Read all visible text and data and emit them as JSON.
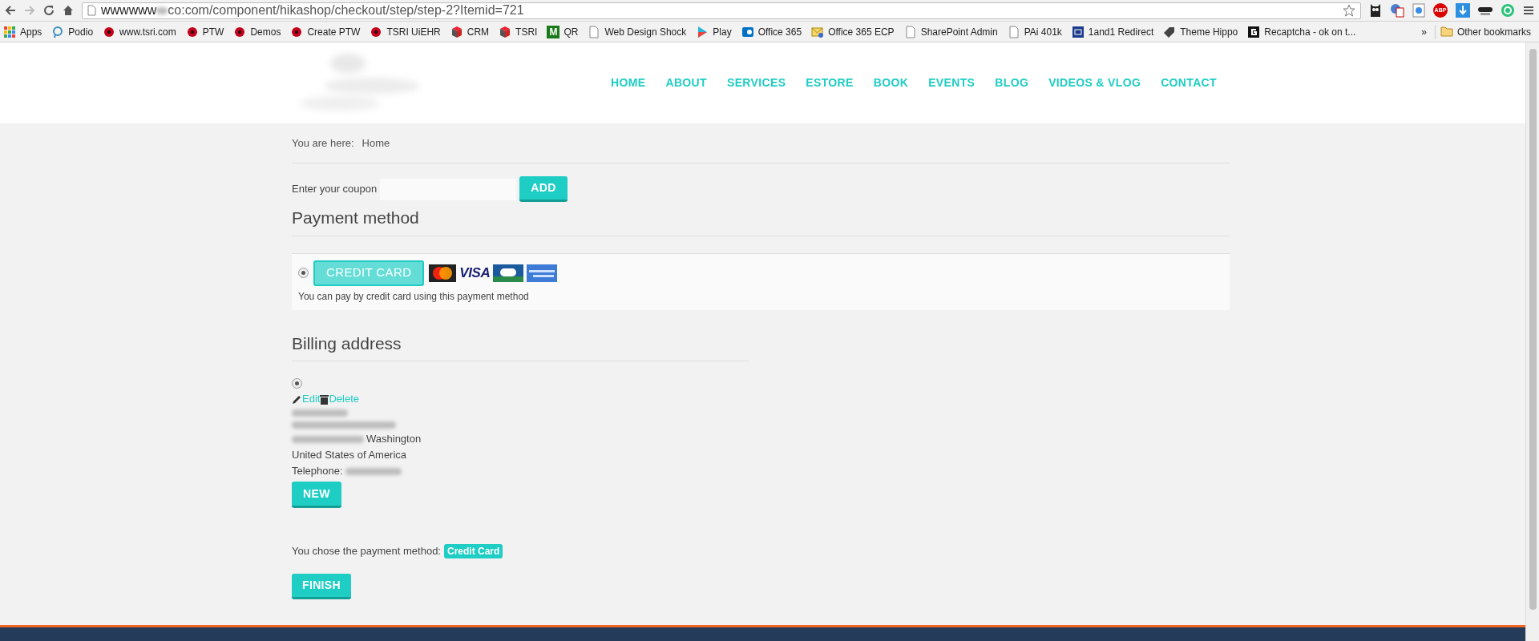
{
  "browser": {
    "url_start": "wwwwww",
    "url_rest": "co:com/component/hikashop/checkout/step/step-2?Itemid=721",
    "bookmarks": [
      {
        "label": "Apps",
        "kind": "apps"
      },
      {
        "label": "Podio",
        "kind": "podio"
      },
      {
        "label": "www.tsri.com",
        "kind": "dot"
      },
      {
        "label": "PTW",
        "kind": "dot"
      },
      {
        "label": "Demos",
        "kind": "dot"
      },
      {
        "label": "Create PTW",
        "kind": "dot"
      },
      {
        "label": "TSRI UiEHR",
        "kind": "dot"
      },
      {
        "label": "CRM",
        "kind": "cube"
      },
      {
        "label": "TSRI",
        "kind": "cube"
      },
      {
        "label": "QR",
        "kind": "m",
        "glyph": "M"
      },
      {
        "label": "Web Design Shock",
        "kind": "page"
      },
      {
        "label": "Play",
        "kind": "play"
      },
      {
        "label": "Office 365",
        "kind": "sharepoint"
      },
      {
        "label": "Office 365 ECP",
        "kind": "envelope"
      },
      {
        "label": "SharePoint Admin",
        "kind": "page"
      },
      {
        "label": "PAi 401k",
        "kind": "page"
      },
      {
        "label": "1and1 Redirect",
        "kind": "oneandone"
      },
      {
        "label": "Theme Hippo",
        "kind": "tag"
      },
      {
        "label": "Recaptcha - ok on t...",
        "kind": "g"
      }
    ],
    "overflow": "»",
    "other_bookmarks": "Other bookmarks",
    "abp": "ABP"
  },
  "nav": [
    {
      "label": "HOME"
    },
    {
      "label": "ABOUT"
    },
    {
      "label": "SERVICES"
    },
    {
      "label": "ESTORE"
    },
    {
      "label": "BOOK"
    },
    {
      "label": "EVENTS"
    },
    {
      "label": "BLOG"
    },
    {
      "label": "VIDEOS & VLOG"
    },
    {
      "label": "CONTACT"
    }
  ],
  "breadcrumb": {
    "label": "You are here:",
    "items": [
      "Home"
    ]
  },
  "coupon": {
    "label": "Enter your coupon",
    "button": "ADD"
  },
  "payment": {
    "heading": "Payment method",
    "methods": [
      {
        "name": "CREDIT CARD",
        "selected": true,
        "description": "You can pay by credit card using this payment method",
        "cards": [
          {
            "kind": "mastercard"
          },
          {
            "kind": "visa",
            "label": "VISA"
          },
          {
            "kind": "cb"
          },
          {
            "kind": "amex"
          }
        ]
      }
    ]
  },
  "billing": {
    "heading": "Billing address",
    "addresses": [
      {
        "selected": true,
        "edit": "Edit",
        "delete": "Delete",
        "city": "Washington",
        "country": "United States of America",
        "telephone_label": "Telephone:"
      }
    ],
    "new_button": "NEW"
  },
  "summary": {
    "text": "You chose the payment method:",
    "method": "Credit Card"
  },
  "finish": "FINISH"
}
